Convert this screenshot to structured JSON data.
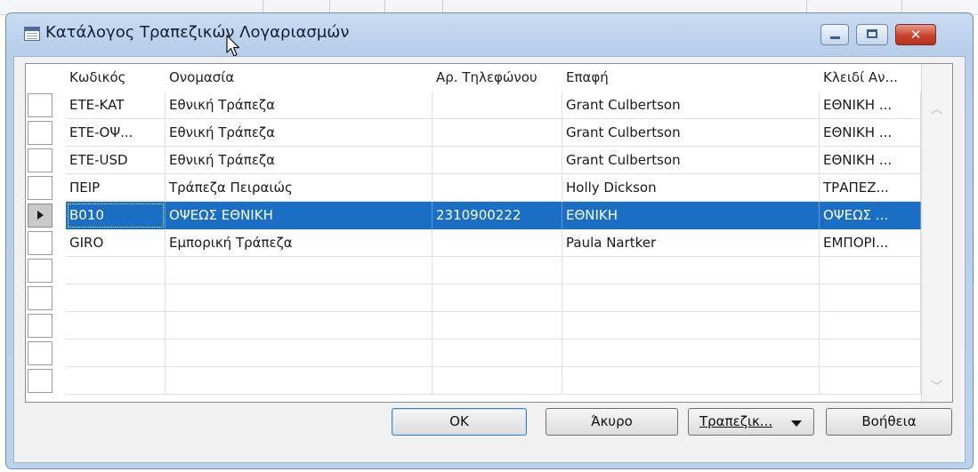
{
  "window": {
    "title": "Κατάλογος Τραπεζικών Λογαριασμών",
    "close_glyph": "✕"
  },
  "grid": {
    "columns": [
      "Κωδικός",
      "Ονομασία",
      "Αρ. Τηλεφώνου",
      "Επαφή",
      "Κλειδί Αν..."
    ],
    "rows": [
      {
        "code": "ETE-KAT",
        "name": "Εθνική Τράπεζα",
        "phone": "",
        "contact": "Grant Culbertson",
        "key": "ΕΘΝΙΚΗ ..."
      },
      {
        "code": "ETE-ΟΨ...",
        "name": "Εθνική Τράπεζα",
        "phone": "",
        "contact": "Grant Culbertson",
        "key": "ΕΘΝΙΚΗ ..."
      },
      {
        "code": "ETE-USD",
        "name": "Εθνική Τράπεζα",
        "phone": "",
        "contact": "Grant Culbertson",
        "key": "ΕΘΝΙΚΗ ..."
      },
      {
        "code": "ΠΕΙΡ",
        "name": "Τράπεζα Πειραιώς",
        "phone": "",
        "contact": "Holly Dickson",
        "key": "ΤΡΑΠΕΖ..."
      },
      {
        "code": "B010",
        "name": "ΟΨΕΩΣ ΕΘΝΙΚΗ",
        "phone": "2310900222",
        "contact": "ΕΘΝΙΚΗ",
        "key": "ΟΨΕΩΣ ...",
        "selected": true
      },
      {
        "code": "GIRO",
        "name": "Εμπορική Τράπεζα",
        "phone": "",
        "contact": "Paula Nartker",
        "key": "ΕΜΠΟΡΙ..."
      }
    ],
    "empty_rows": 5,
    "scroll_up_glyph": "︿",
    "scroll_down_glyph": "﹀"
  },
  "buttons": {
    "ok": "OK",
    "cancel": "Άκυρο",
    "bank_menu": "Τραπεζικ...",
    "help": "Βοήθεια"
  },
  "colors": {
    "selection": "#1a6fc4",
    "title_bar": "#c9dcf2",
    "close_button": "#c8432f"
  }
}
